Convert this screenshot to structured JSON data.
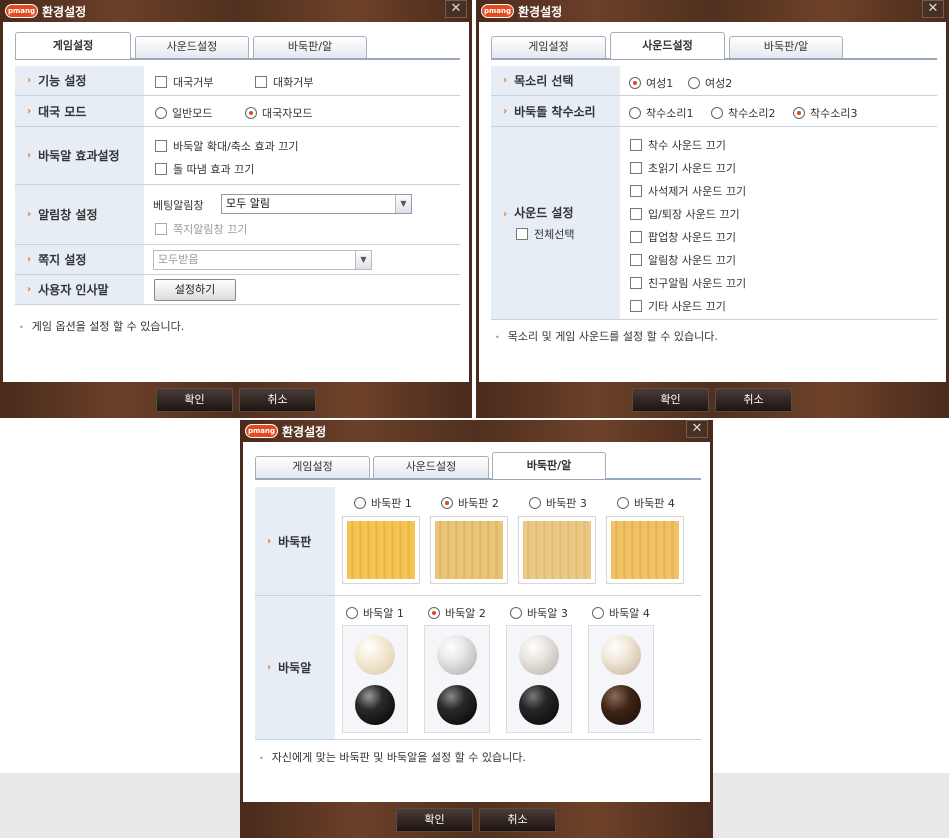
{
  "dialog_title": "환경설정",
  "logo_text": "pmang",
  "close_glyph": "✕",
  "tabs": [
    "게임설정",
    "사운드설정",
    "바둑판/알"
  ],
  "confirm_label": "확인",
  "cancel_label": "취소",
  "game": {
    "feature_label": "기능 설정",
    "decline_match": "대국거부",
    "decline_chat": "대화거부",
    "match_mode_label": "대국 모드",
    "normal_mode": "일반모드",
    "player_mode": "대국자모드",
    "stone_effect_label": "바둑알 효과설정",
    "zoom_effect_off": "바둑알 확대/축소 효과 끄기",
    "shake_effect_off": "돌 따냄 효과 끄기",
    "notify_label": "알림창 설정",
    "betting_label": "베팅알림창",
    "betting_value": "모두 알림",
    "note_notify_off": "쪽지알림창 끄기",
    "note_label": "쪽지 설정",
    "note_value": "모두받음",
    "greeting_label": "사용자 인사말",
    "greeting_button": "설정하기",
    "footer": "게임 옵션을 설정 할 수 있습니다."
  },
  "sound": {
    "voice_label": "목소리 선택",
    "voice_options": [
      "여성1",
      "여성2"
    ],
    "stone_sound_label": "바둑돌 착수소리",
    "stone_sound_options": [
      "착수소리1",
      "착수소리2",
      "착수소리3"
    ],
    "settings_label": "사운드 설정",
    "select_all": "전체선택",
    "toggles": [
      "착수 사운드 끄기",
      "초읽기 사운드 끄기",
      "사석제거 사운드 끄기",
      "입/퇴장 사운드 끄기",
      "팝업창 사운드 끄기",
      "알림창 사운드 끄기",
      "친구알림 사운드 끄기",
      "기타 사운드 끄기"
    ],
    "footer": "목소리 및 게임 사운드를 설정 할 수 있습니다."
  },
  "board": {
    "board_label": "바둑판",
    "board_options": [
      "바둑판 1",
      "바둑판 2",
      "바둑판 3",
      "바둑판 4"
    ],
    "stone_label": "바둑알",
    "stone_options": [
      "바둑알 1",
      "바둑알 2",
      "바둑알 3",
      "바둑알 4"
    ],
    "footer": "자신에게 맞는 바둑판 및 바둑알을 설정 할 수 있습니다."
  },
  "colors": {
    "accent_arrow": "#e8731d",
    "label_bg": "#e6edf5",
    "frame": "#5a3624"
  }
}
